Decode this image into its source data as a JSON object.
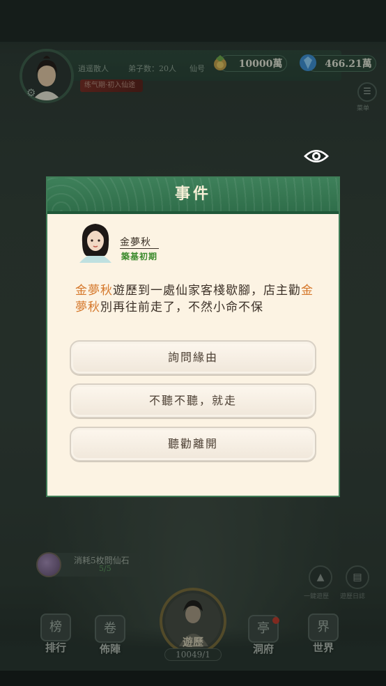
{
  "hud": {
    "player_name": "逍遥散人",
    "disciples": "弟子数：20人",
    "extra": "仙号",
    "rank_tag": "练气期·初入仙途",
    "currency1": "10000萬",
    "currency2": "466.21萬",
    "menu_label": "菜单"
  },
  "dialog": {
    "title": "事件",
    "character_name": "金夢秋",
    "character_realm": "築基初期",
    "event": {
      "name1": "金夢秋",
      "text1": "遊歷到一處仙家客棧歇腳，店主勸",
      "name2": "金夢秋",
      "text2": "別再往前走了，不然小命不保"
    },
    "choices": [
      "詢問緣由",
      "不聽不聽，就走",
      "聽勸離開"
    ]
  },
  "bottom": {
    "cost_text": "消耗5枚問仙石",
    "cost_count": "5/5",
    "side1_label": "一鍵遊歷",
    "side2_label": "遊歷日誌",
    "nav": [
      "排行",
      "佈陣",
      "遊歷",
      "洞府",
      "世界"
    ],
    "ticket": "10049/1"
  },
  "colors": {
    "accent_green": "#3e805a",
    "highlight_orange": "#d5772a",
    "realm_green": "#3b8a2c"
  }
}
